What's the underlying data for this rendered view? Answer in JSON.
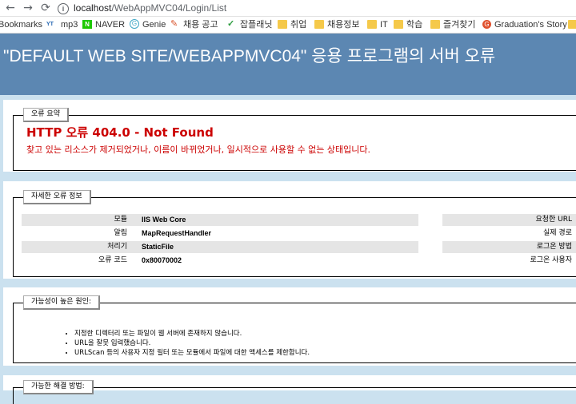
{
  "browser": {
    "back_icon": "back-arrow-icon",
    "forward_icon": "forward-arrow-icon",
    "reload_icon": "reload-icon",
    "info_glyph": "i",
    "url_host": "localhost",
    "url_path": "/WebAppMVC04/Login/List"
  },
  "bookmarks": [
    {
      "label": "Bookmarks",
      "icon": "none"
    },
    {
      "label": "mp3",
      "icon": "yt-icon",
      "glyph": "YT"
    },
    {
      "label": "NAVER",
      "icon": "naver-icon",
      "glyph": "N"
    },
    {
      "label": "Genie",
      "icon": "genie-icon",
      "glyph": "G"
    },
    {
      "label": "채용 공고",
      "icon": "pen-icon",
      "glyph": "✎"
    },
    {
      "label": "잡플래닛",
      "icon": "check-icon",
      "glyph": "✓"
    },
    {
      "label": "취업",
      "icon": "folder-icon"
    },
    {
      "label": "채용정보",
      "icon": "folder-icon"
    },
    {
      "label": "IT",
      "icon": "folder-icon"
    },
    {
      "label": "학습",
      "icon": "folder-icon"
    },
    {
      "label": "즐겨찾기",
      "icon": "folder-icon"
    },
    {
      "label": "Graduation's Story :",
      "icon": "graduation-icon",
      "glyph": "G"
    },
    {
      "label": "",
      "icon": "folder-icon"
    }
  ],
  "header": {
    "title": "\"DEFAULT WEB SITE/WEBAPPMVC04\" 응용 프로그램의 서버 오류"
  },
  "summary": {
    "legend": "오류 요약",
    "title": "HTTP 오류 404.0 - Not Found",
    "description": "찾고 있는 리소스가 제거되었거나, 이름이 바뀌었거나, 일시적으로 사용할 수 없는 상태입니다."
  },
  "details": {
    "legend": "자세한 오류 정보",
    "left_rows": [
      {
        "key": "모듈",
        "value": "IIS Web Core"
      },
      {
        "key": "알림",
        "value": "MapRequestHandler"
      },
      {
        "key": "처리기",
        "value": "StaticFile"
      },
      {
        "key": "오류 코드",
        "value": "0x80070002"
      }
    ],
    "right_rows": [
      {
        "key": "요청한 URL"
      },
      {
        "key": "실제 경로"
      },
      {
        "key": "로그온 방법"
      },
      {
        "key": "로그온 사용자"
      }
    ]
  },
  "causes": {
    "legend": "가능성이 높은 원인:",
    "items": [
      "지정한 디렉터리 또는 파일이 웹 서버에 존재하지 않습니다.",
      "URL을 잘못 입력했습니다.",
      "URLScan 등의 사용자 지정 필터 또는 모듈에서 파일에 대한 액세스를 제한합니다."
    ]
  },
  "next": {
    "legend": "가능한 해결 방법:"
  }
}
